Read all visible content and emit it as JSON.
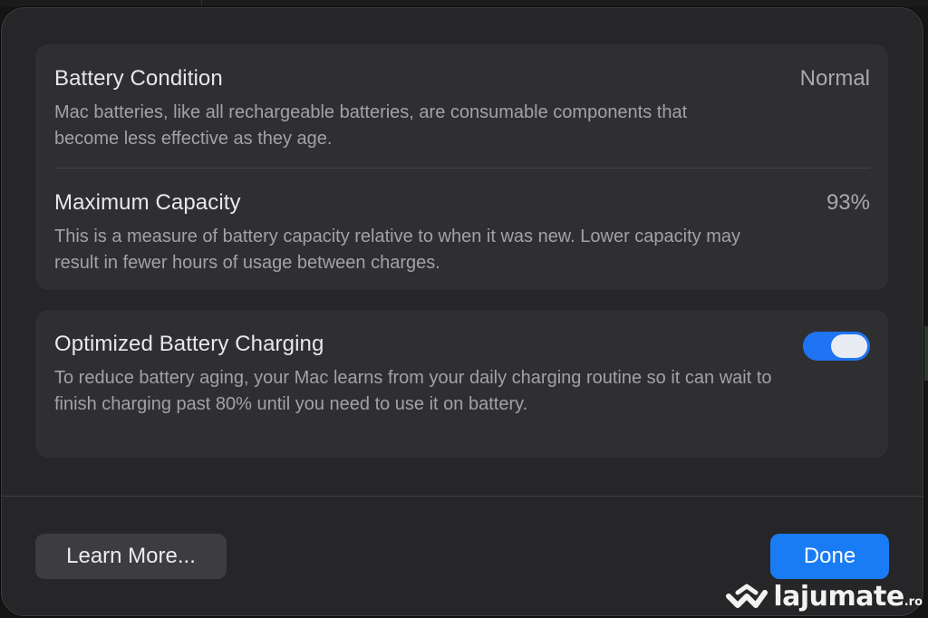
{
  "battery_condition": {
    "title": "Battery Condition",
    "value": "Normal",
    "description": "Mac batteries, like all rechargeable batteries, are consumable components that become less effective as they age."
  },
  "maximum_capacity": {
    "title": "Maximum Capacity",
    "value": "93%",
    "description": "This is a measure of battery capacity relative to when it was new. Lower capacity may result in fewer hours of usage between charges."
  },
  "optimized_charging": {
    "title": "Optimized Battery Charging",
    "enabled": true,
    "description": "To reduce battery aging, your Mac learns from your daily charging routine so it can wait to finish charging past 80% until you need to use it on battery."
  },
  "buttons": {
    "learn_more": "Learn More...",
    "done": "Done"
  },
  "watermark": {
    "text": "lajumate",
    "suffix": ".ro"
  },
  "colors": {
    "accent": "#1a7cf5",
    "dialog_bg": "#262628",
    "group_bg": "#2f2f31"
  }
}
